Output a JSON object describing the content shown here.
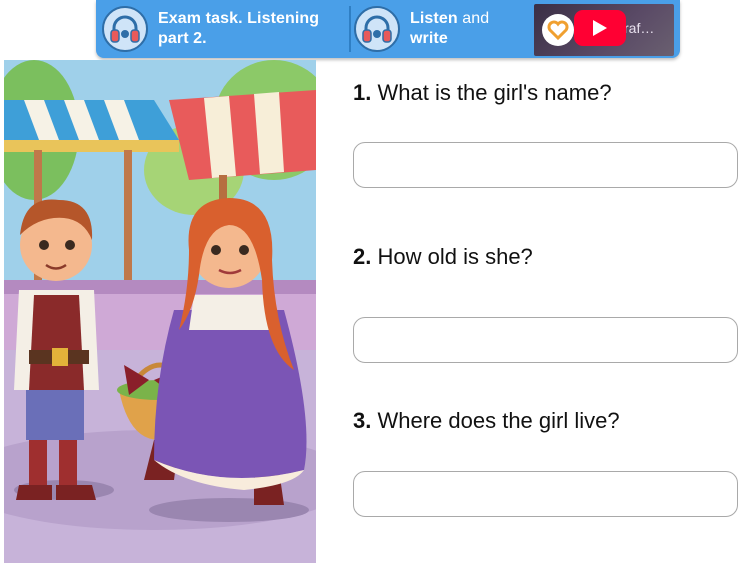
{
  "tabs": [
    {
      "label_bold": "Exam task. Listening part 2.",
      "label_rest": "",
      "icon": "headphones-icon"
    },
    {
      "label_bold": "Listen",
      "label_rest": " and",
      "label_line2": "write",
      "icon": "headphones-icon"
    }
  ],
  "video": {
    "title": "raf…",
    "icon": "youtube-play-icon"
  },
  "questions": [
    {
      "number": "1.",
      "text": "What is the girl's name?",
      "answer": "",
      "placeholder": ""
    },
    {
      "number": "2.",
      "text": "How old is she?",
      "answer": "",
      "placeholder": ""
    },
    {
      "number": "3.",
      "text": "Where does the girl live?",
      "answer": "",
      "placeholder": ""
    }
  ],
  "colors": {
    "tab_bar": "#4a9fe8",
    "youtube_red": "#ff0033",
    "input_border": "#a9a9a9"
  }
}
